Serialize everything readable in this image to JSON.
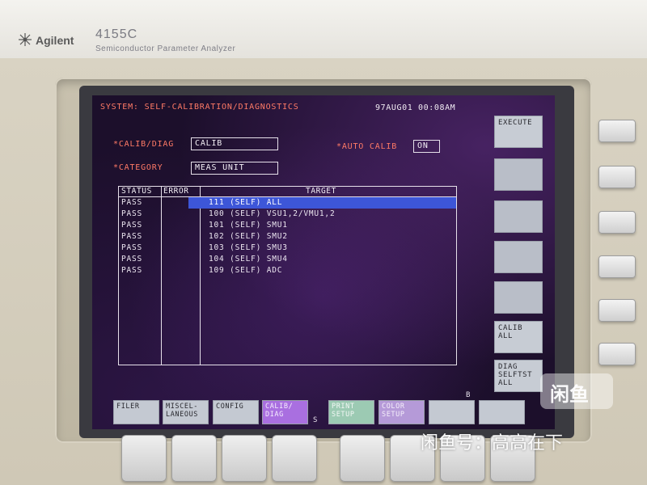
{
  "instrument": {
    "brand": "Agilent",
    "model": "4155C",
    "model_description": "Semiconductor Parameter Analyzer"
  },
  "screen": {
    "title": "SYSTEM: SELF-CALIBRATION/DIAGNOSTICS",
    "datetime": "97AUG01 00:08AM",
    "calib_diag": {
      "label": "*CALIB/DIAG",
      "value": "CALIB"
    },
    "auto_calib": {
      "label": "*AUTO CALIB",
      "value": "ON"
    },
    "category": {
      "label": "*CATEGORY",
      "value": "MEAS UNIT"
    },
    "table": {
      "headers": {
        "status": "STATUS",
        "error": "ERROR",
        "target": "TARGET"
      },
      "rows": [
        {
          "status": "PASS",
          "target": "111 (SELF) ALL",
          "selected": true
        },
        {
          "status": "PASS",
          "target": "100 (SELF) VSU1,2/VMU1,2"
        },
        {
          "status": "PASS",
          "target": "101 (SELF) SMU1"
        },
        {
          "status": "PASS",
          "target": "102 (SELF) SMU2"
        },
        {
          "status": "PASS",
          "target": "103 (SELF) SMU3"
        },
        {
          "status": "PASS",
          "target": "104 (SELF) SMU4"
        },
        {
          "status": "PASS",
          "target": "109 (SELF) ADC"
        }
      ]
    },
    "side_softkeys": [
      "EXECUTE",
      "",
      "",
      "",
      "",
      "CALIB\nALL",
      "DIAG\nSELFTST\nALL"
    ],
    "bottom_softkeys": [
      {
        "label": "FILER"
      },
      {
        "label": "MISCEL-\nLANEOUS"
      },
      {
        "label": "CONFIG"
      },
      {
        "label": "CALIB/\nDIAG",
        "active": true
      },
      {
        "label": "PRINT\nSETUP"
      },
      {
        "label": "COLOR\nSETUP"
      },
      {
        "label": ""
      },
      {
        "label": ""
      }
    ],
    "scroll_markers": {
      "left": "S",
      "right": "B"
    }
  },
  "watermark": {
    "logo_text": "闲鱼",
    "caption": "闲鱼号：高高在下"
  }
}
